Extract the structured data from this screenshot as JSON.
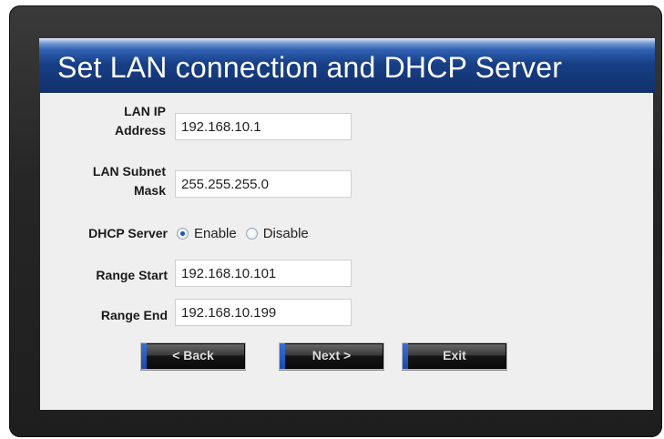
{
  "dialog": {
    "title": "Set LAN connection and DHCP Server"
  },
  "form": {
    "lan_ip": {
      "label_line1": "LAN IP",
      "label_line2": "Address",
      "value": "192.168.10.1"
    },
    "subnet": {
      "label_line1": "LAN Subnet",
      "label_line2": "Mask",
      "value": "255.255.255.0"
    },
    "dhcp": {
      "label": "DHCP Server",
      "enable_label": "Enable",
      "disable_label": "Disable",
      "selected": "Enable"
    },
    "range_start": {
      "label": "Range Start",
      "value": "192.168.10.101"
    },
    "range_end": {
      "label": "Range End",
      "value": "192.168.10.199"
    }
  },
  "buttons": {
    "back": "< Back",
    "next": "Next >",
    "exit": "Exit"
  },
  "colors": {
    "title_band": "#173f86",
    "panel": "#efefef",
    "frame": "#262626",
    "button_accent": "#1a4aa8"
  }
}
